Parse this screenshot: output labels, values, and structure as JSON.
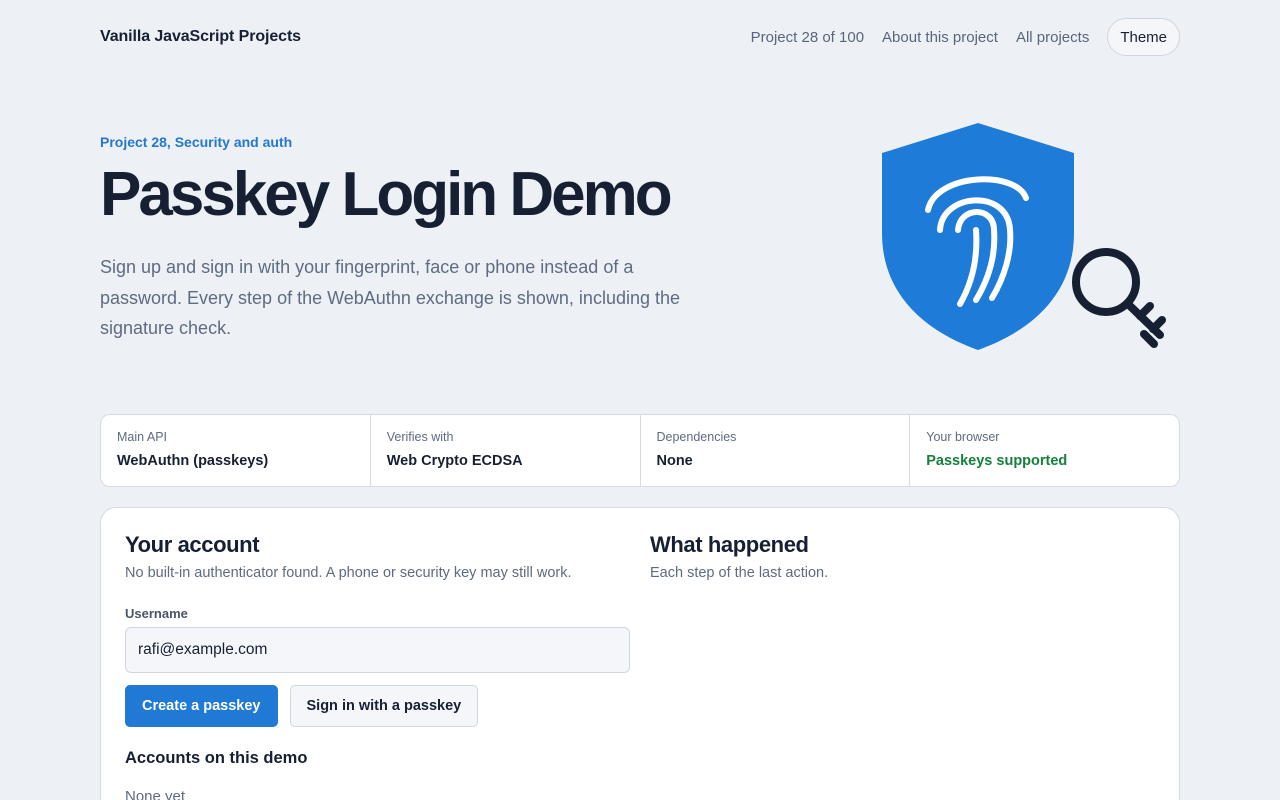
{
  "header": {
    "brand": "Vanilla JavaScript Projects",
    "project_counter": "Project 28 of 100",
    "about_link": "About this project",
    "all_link": "All projects",
    "theme_button": "Theme"
  },
  "hero": {
    "eyebrow": "Project 28, Security and auth",
    "title": "Passkey Login Demo",
    "description": "Sign up and sign in with your fingerprint, face or phone instead of a password. Every step of the WebAuthn exchange is shown, including the signature check."
  },
  "illustration": {
    "icons": [
      "shield-icon",
      "fingerprint-icon",
      "key-icon"
    ],
    "colors": {
      "shield": "#1f7bd8",
      "fingerprint": "#ffffff",
      "key": "#172033"
    }
  },
  "stats": [
    {
      "label": "Main API",
      "value": "WebAuthn (passkeys)"
    },
    {
      "label": "Verifies with",
      "value": "Web Crypto ECDSA"
    },
    {
      "label": "Dependencies",
      "value": "None"
    },
    {
      "label": "Your browser",
      "value": "Passkeys supported",
      "status_color": "#16803c"
    }
  ],
  "account": {
    "title": "Your account",
    "subtitle": "No built-in authenticator found. A phone or security key may still work.",
    "username_label": "Username",
    "username_value": "rafi@example.com",
    "create_button": "Create a passkey",
    "signin_button": "Sign in with a passkey",
    "accounts_heading": "Accounts on this demo",
    "accounts_empty": "None yet"
  },
  "log": {
    "title": "What happened",
    "subtitle": "Each step of the last action."
  },
  "colors": {
    "accent": "#2079d4",
    "background": "#edf1f5",
    "success": "#16803c",
    "text": "#172033"
  }
}
